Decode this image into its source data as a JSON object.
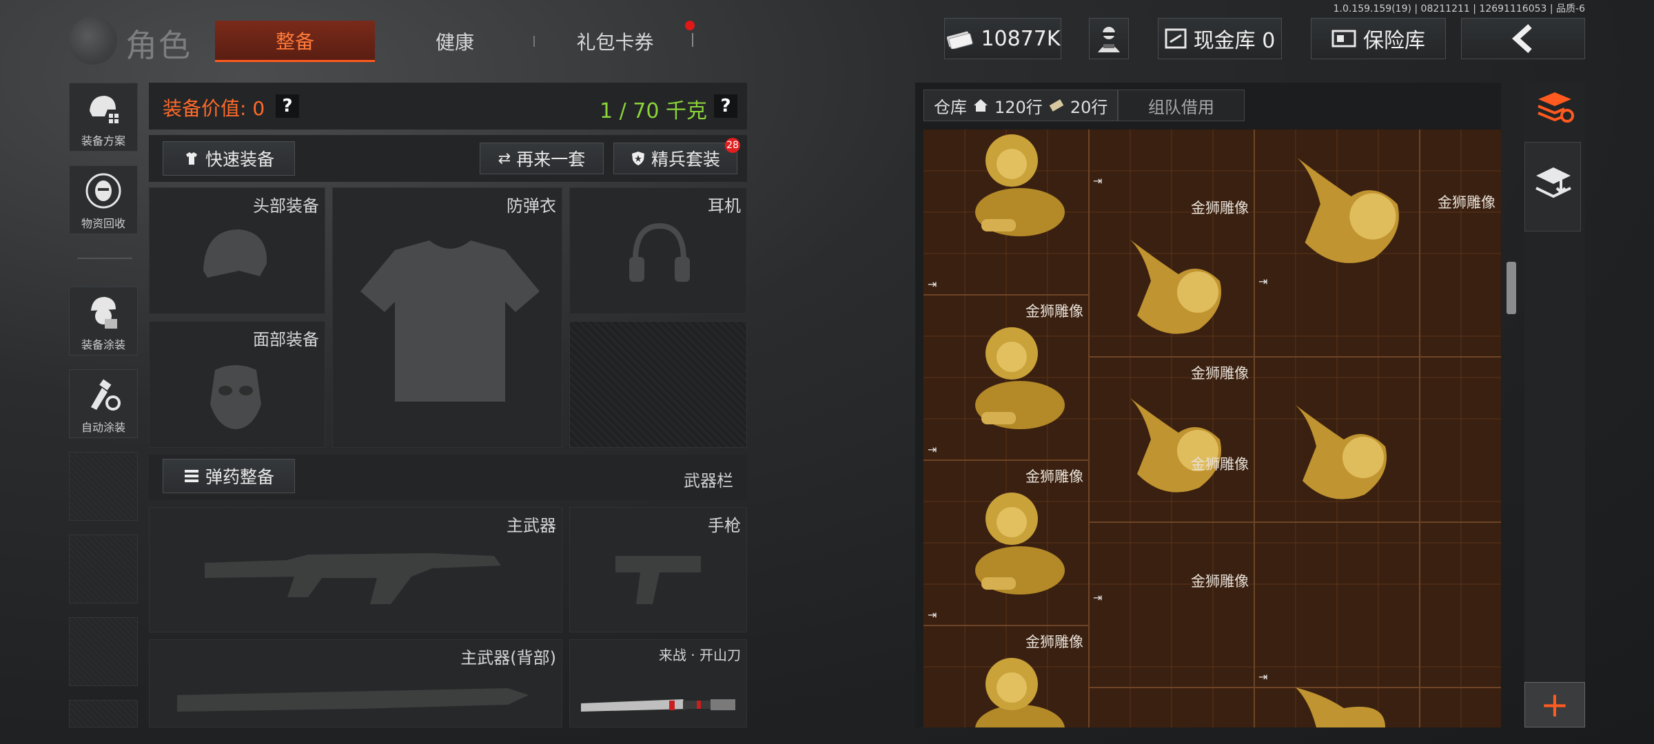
{
  "version": "1.0.159.159(19) | 08211211 | 12691116053 | 品质-6",
  "header": {
    "title": "角色",
    "tabs": [
      {
        "label": "整备",
        "active": true
      },
      {
        "label": "健康",
        "active": false
      },
      {
        "label": "礼包卡券",
        "active": false,
        "has_notification": true
      }
    ],
    "money": "10877K",
    "cash_vault": "现金库 0",
    "safe_box": "保险库"
  },
  "sidebar": [
    {
      "label": "装备方案",
      "icon": "helmet-plan-icon"
    },
    {
      "label": "物资回收",
      "icon": "recycle-face-icon"
    },
    {
      "label": "装备涂装",
      "icon": "soldier-paint-icon"
    },
    {
      "label": "自动涂装",
      "icon": "auto-brush-icon"
    }
  ],
  "equipment": {
    "value_label": "装备价值: 0",
    "weight": "1 / 70 千克",
    "help": "?",
    "quick_equip": "快速装备",
    "again_set": "再来一套",
    "elite_set": "精兵套装",
    "elite_badge": "28",
    "slots": {
      "head": "头部装备",
      "armor": "防弹衣",
      "headset": "耳机",
      "face": "面部装备"
    },
    "ammo_button": "弹药整备",
    "weapon_bar": "武器栏",
    "weapons": {
      "primary": "主武器",
      "pistol": "手枪",
      "primary_back": "主武器(背部)",
      "melee": "来战 · 开山刀"
    }
  },
  "warehouse": {
    "tab_label": "仓库",
    "rows_house": "120行",
    "rows_cash": "20行",
    "team_borrow": "组队借用",
    "item_name": "金狮雕像"
  },
  "colors": {
    "accent": "#ff5a1f",
    "weight_green": "#8cd43a",
    "grid_bg": "#3e1f0e",
    "gold": "#c9a23a"
  }
}
